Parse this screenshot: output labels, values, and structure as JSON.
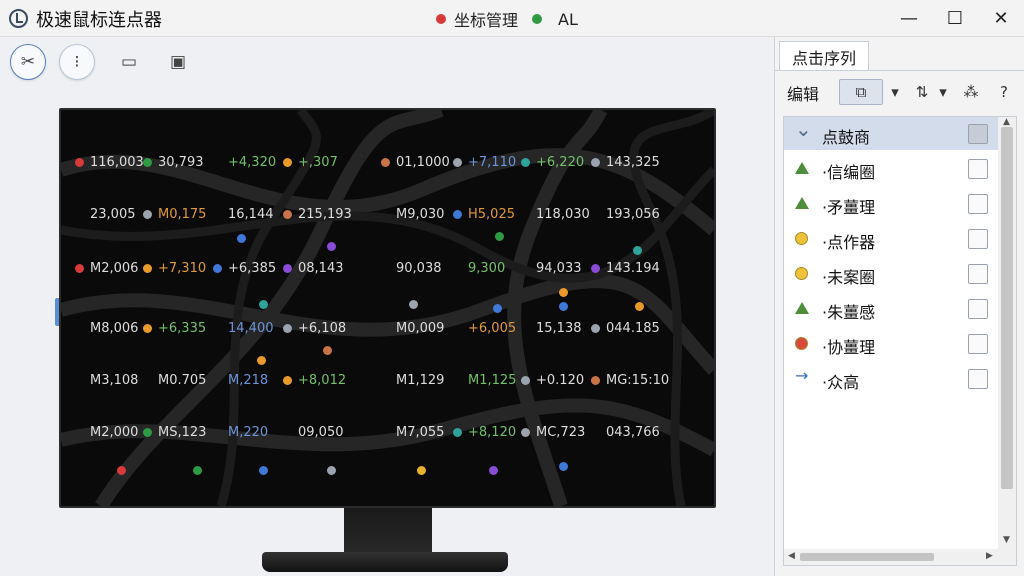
{
  "window": {
    "title": "极速鼠标连点器",
    "center_label": "坐标管理",
    "center_label_2": "AL",
    "minimize": "—",
    "maximize": "☐",
    "close": "✕"
  },
  "toolbar": [
    {
      "name": "pointer-tool-button",
      "icon": "✂",
      "style": "active"
    },
    {
      "name": "sequence-tool-button",
      "icon": "⁝",
      "style": "circled"
    },
    {
      "name": "screen-tool-button",
      "icon": "▭",
      "style": ""
    },
    {
      "name": "chip-tool-button",
      "icon": "▣",
      "style": ""
    }
  ],
  "colors": {
    "red": "#d83a3a",
    "green": "#2f9a44",
    "orange": "#e89a2a",
    "blue": "#3f78d6",
    "purple": "#8a4bd6",
    "gray": "#9aa3ae",
    "teal": "#2fa39a",
    "brown": "#c87448",
    "yellow": "#e8b22a"
  },
  "screen_points": [
    {
      "text": "116,003",
      "dot": "red"
    },
    {
      "text": "30,793",
      "dot": "green"
    },
    {
      "text": "+4,320",
      "dot": "",
      "tone": "cg"
    },
    {
      "text": "+,307",
      "dot": "orange",
      "tone": "cg"
    },
    {
      "text": "01,1000",
      "dot": "brown"
    },
    {
      "text": "+7,110",
      "dot": "gray",
      "tone": "cb"
    },
    {
      "text": "+6,220",
      "dot": "teal",
      "tone": "cg"
    },
    {
      "text": "143,325",
      "dot": "gray"
    },
    {
      "text": "23,005",
      "dot": ""
    },
    {
      "text": "M0,175",
      "dot": "gray",
      "tone": "co"
    },
    {
      "text": "16,144",
      "dot": ""
    },
    {
      "text": "215,193",
      "dot": "brown"
    },
    {
      "text": "M9,030",
      "dot": ""
    },
    {
      "text": "H5,025",
      "dot": "blue",
      "tone": "co"
    },
    {
      "text": "118,030",
      "dot": ""
    },
    {
      "text": "193,056",
      "dot": ""
    },
    {
      "text": "M2,006",
      "dot": "red"
    },
    {
      "text": "+7,310",
      "dot": "orange",
      "tone": "co"
    },
    {
      "text": "+6,385",
      "dot": "blue"
    },
    {
      "text": "08,143",
      "dot": "purple"
    },
    {
      "text": "90,038",
      "dot": ""
    },
    {
      "text": "9,300",
      "dot": "",
      "tone": "cg"
    },
    {
      "text": "94,033",
      "dot": ""
    },
    {
      "text": "143.194",
      "dot": "purple"
    },
    {
      "text": "M8,006",
      "dot": ""
    },
    {
      "text": "+6,335",
      "dot": "orange",
      "tone": "cg"
    },
    {
      "text": "14,400",
      "dot": "",
      "tone": "cb"
    },
    {
      "text": "+6,108",
      "dot": "gray"
    },
    {
      "text": "M0,009",
      "dot": ""
    },
    {
      "text": "+6,005",
      "dot": "",
      "tone": "co"
    },
    {
      "text": "15,138",
      "dot": ""
    },
    {
      "text": "044.185",
      "dot": "gray"
    },
    {
      "text": "M3,108",
      "dot": ""
    },
    {
      "text": "M0.705",
      "dot": ""
    },
    {
      "text": "M,218",
      "dot": "",
      "tone": "cb"
    },
    {
      "text": "+8,012",
      "dot": "orange",
      "tone": "cg"
    },
    {
      "text": "M1,129",
      "dot": ""
    },
    {
      "text": "M1,125",
      "dot": "",
      "tone": "cg"
    },
    {
      "text": "+0.120",
      "dot": "gray"
    },
    {
      "text": "MG:15:10",
      "dot": "brown"
    },
    {
      "text": "M2,000",
      "dot": ""
    },
    {
      "text": "MS,123",
      "dot": "green"
    },
    {
      "text": "M,220",
      "dot": "",
      "tone": "cb"
    },
    {
      "text": "09,050",
      "dot": ""
    },
    {
      "text": "M7,055",
      "dot": ""
    },
    {
      "text": "+8,120",
      "dot": "teal",
      "tone": "cg"
    },
    {
      "text": "MC,723",
      "dot": "gray"
    },
    {
      "text": "043,766",
      "dot": ""
    }
  ],
  "screen_markers": [
    "blue",
    "purple",
    "teal",
    "green",
    "gray",
    "blue",
    "orange",
    "blue",
    "orange",
    "orange",
    "brown",
    "red",
    "green",
    "blue",
    "gray",
    "yellow",
    "purple",
    "blue",
    "teal"
  ],
  "panel": {
    "tab": "点击序列",
    "edit_label": "编辑",
    "tools": [
      {
        "name": "copy-tool-button",
        "icon": "⧉",
        "style": "boxed"
      },
      {
        "name": "copy-dropdown-button",
        "icon": "▾",
        "style": ""
      },
      {
        "name": "sort-tool-button",
        "icon": "⇅",
        "style": ""
      },
      {
        "name": "sort-dropdown-button",
        "icon": "▾",
        "style": ""
      },
      {
        "name": "shuffle-tool-button",
        "icon": "⁂",
        "style": ""
      },
      {
        "name": "help-button",
        "icon": "?",
        "style": ""
      }
    ],
    "items": [
      {
        "label": "点鼓商",
        "icon": "chevron",
        "color": "#556a88",
        "selected": true
      },
      {
        "label": "·信编圈",
        "icon": "triangle",
        "color": "#4d8e3b"
      },
      {
        "label": "·矛薑理",
        "icon": "triangle",
        "color": "#4d8e3b"
      },
      {
        "label": "·点作器",
        "icon": "circle",
        "color": "#f0c23a"
      },
      {
        "label": "·未案圈",
        "icon": "circle",
        "color": "#f0c23a"
      },
      {
        "label": "·朱薑感",
        "icon": "triangle",
        "color": "#4d8e3b"
      },
      {
        "label": "·协薑理",
        "icon": "circle",
        "color": "#d84a3a"
      },
      {
        "label": "·众高",
        "icon": "arrow",
        "color": "#3a6ec8"
      }
    ]
  }
}
